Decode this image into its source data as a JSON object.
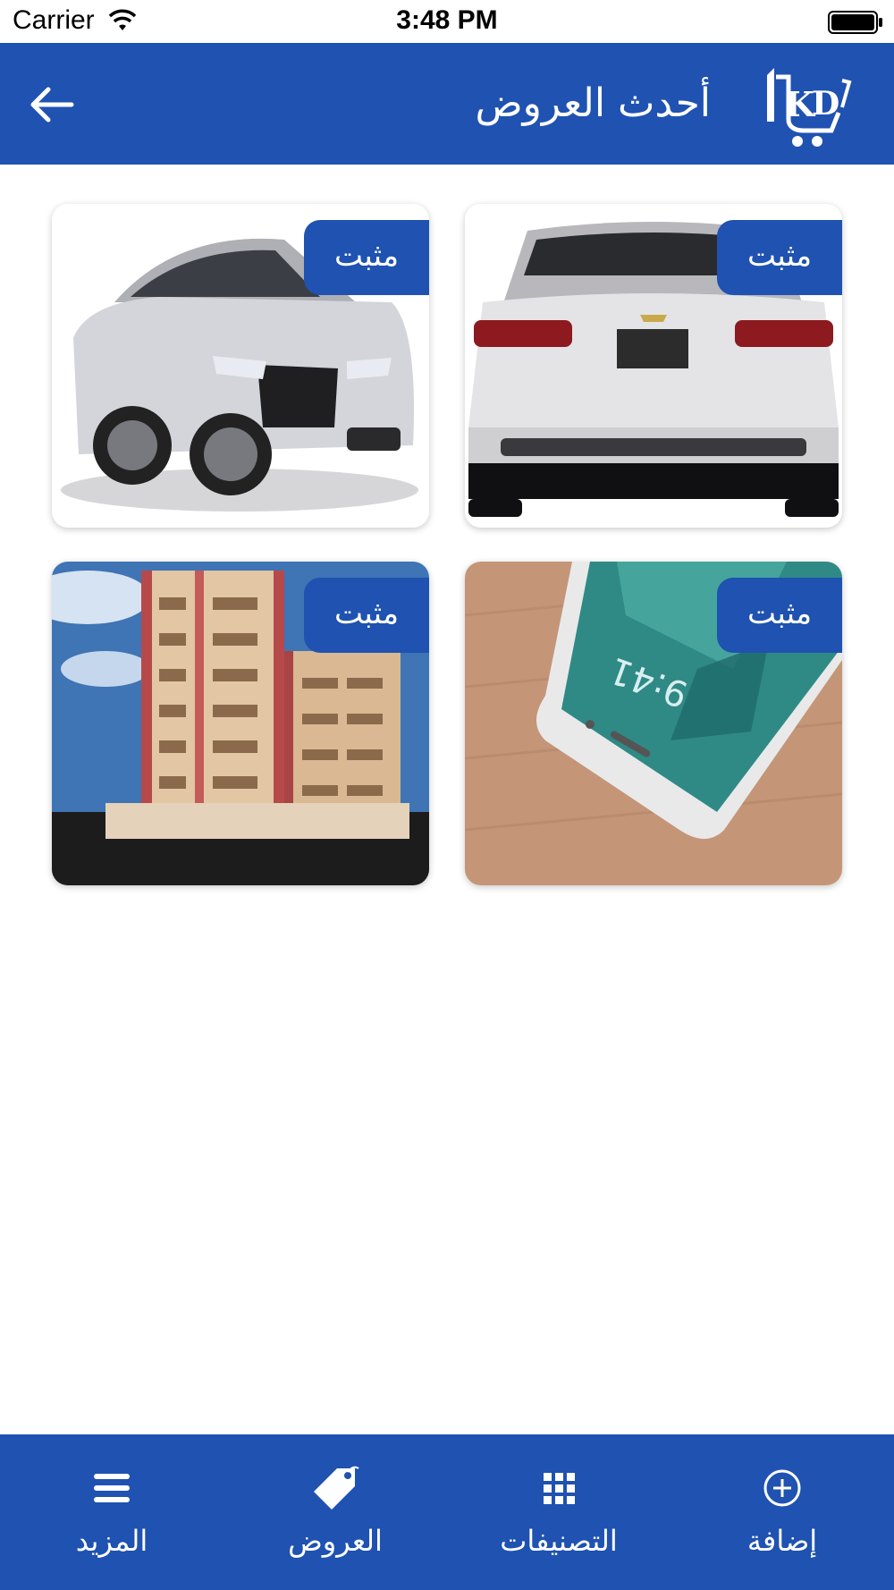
{
  "status_bar": {
    "carrier": "Carrier",
    "time": "3:48 PM"
  },
  "header": {
    "title": "أحدث العروض",
    "back_icon": "arrow-left-icon",
    "logo_text": "1KD"
  },
  "cards": [
    {
      "badge": "مثبت",
      "image": "white chevrolet sedan rear view"
    },
    {
      "badge": "مثبت",
      "image": "silver jaguar sedan front view"
    },
    {
      "badge": "مثبت",
      "image": "smartphone on wooden table"
    },
    {
      "badge": "مثبت",
      "image": "residential apartment building"
    }
  ],
  "tab_bar": {
    "items": [
      {
        "label": "إضافة",
        "icon": "add-circle-icon"
      },
      {
        "label": "التصنيفات",
        "icon": "grid-icon"
      },
      {
        "label": "العروض",
        "icon": "tag-icon"
      },
      {
        "label": "المزيد",
        "icon": "menu-icon"
      }
    ]
  },
  "colors": {
    "primary": "#1f52b1",
    "background": "#ffffff"
  }
}
